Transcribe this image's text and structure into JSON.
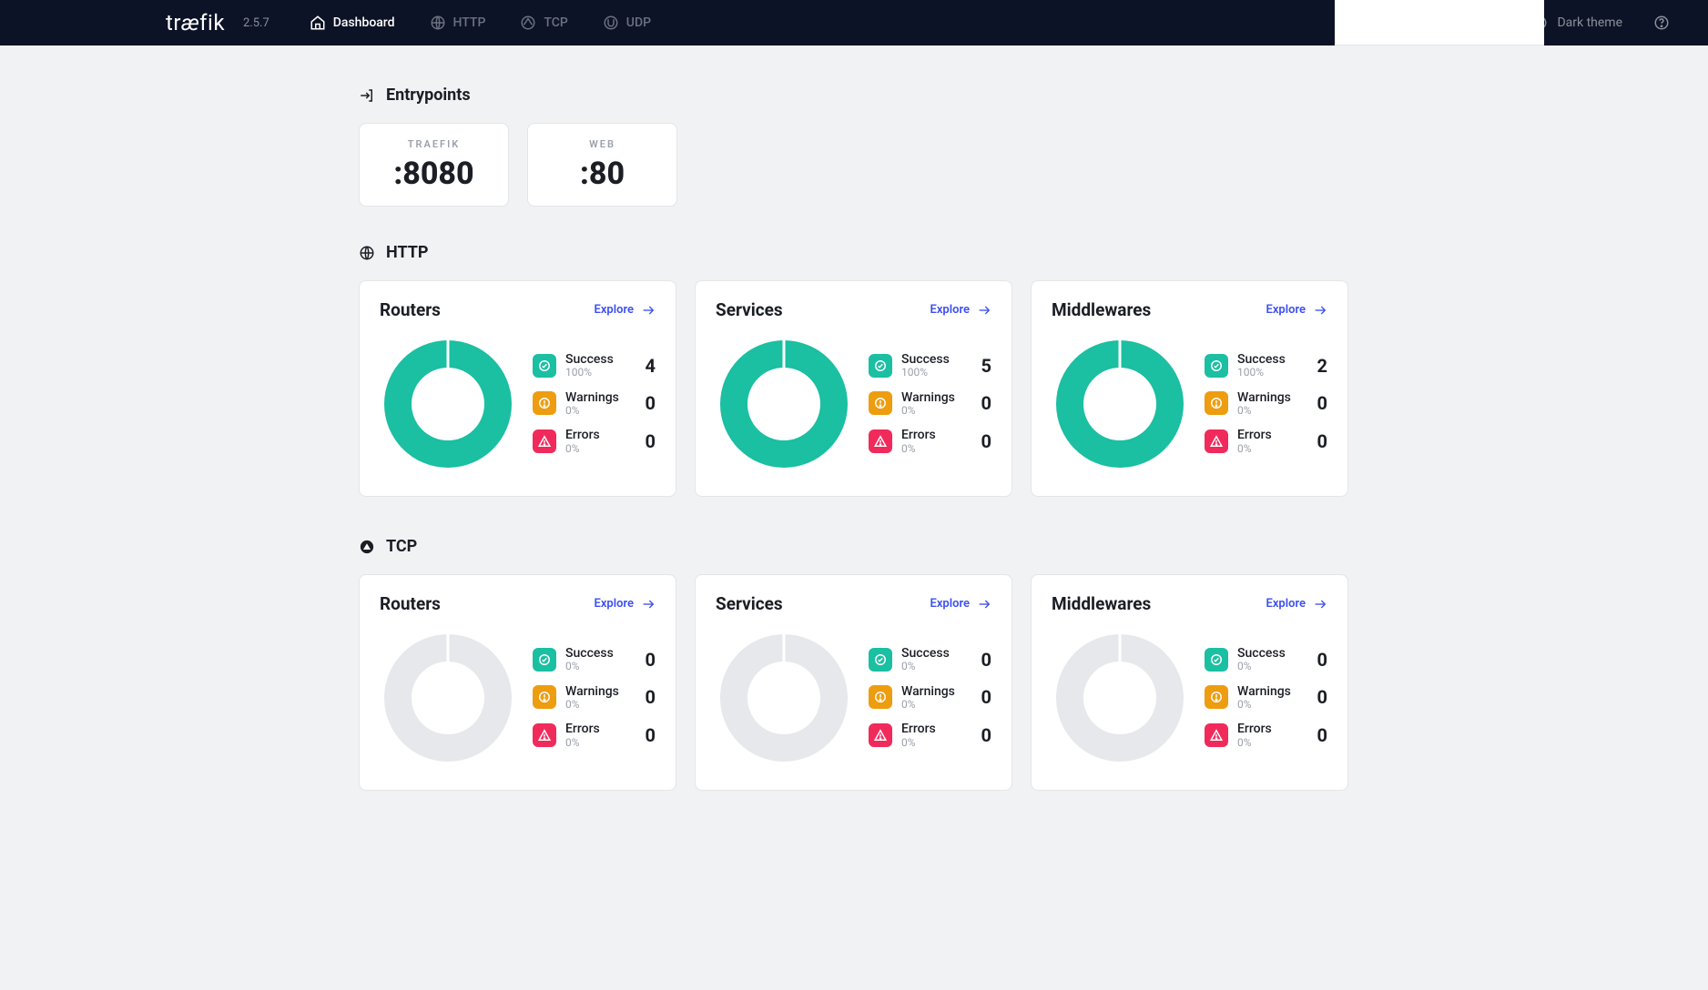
{
  "app": {
    "name": "træfik",
    "version": "2.5.7"
  },
  "nav": {
    "dashboard": "Dashboard",
    "http": "HTTP",
    "tcp": "TCP",
    "udp": "UDP",
    "dark_theme": "Dark theme"
  },
  "colors": {
    "success": "#1bbfa2",
    "warning": "#ed9d0f",
    "error": "#f12a5c",
    "empty": "#e6e8ec",
    "accent": "#3b4ff0"
  },
  "labels": {
    "entrypoints": "Entrypoints",
    "http": "HTTP",
    "tcp": "TCP",
    "explore": "Explore",
    "success": "Success",
    "warnings": "Warnings",
    "errors": "Errors"
  },
  "entrypoints": [
    {
      "name": "TRAEFIK",
      "port": ":8080"
    },
    {
      "name": "WEB",
      "port": ":80"
    }
  ],
  "chart_data": [
    {
      "type": "pie",
      "group": "HTTP",
      "title": "Routers",
      "series": [
        {
          "name": "Success",
          "value": 4,
          "pct": "100%"
        },
        {
          "name": "Warnings",
          "value": 0,
          "pct": "0%"
        },
        {
          "name": "Errors",
          "value": 0,
          "pct": "0%"
        }
      ]
    },
    {
      "type": "pie",
      "group": "HTTP",
      "title": "Services",
      "series": [
        {
          "name": "Success",
          "value": 5,
          "pct": "100%"
        },
        {
          "name": "Warnings",
          "value": 0,
          "pct": "0%"
        },
        {
          "name": "Errors",
          "value": 0,
          "pct": "0%"
        }
      ]
    },
    {
      "type": "pie",
      "group": "HTTP",
      "title": "Middlewares",
      "series": [
        {
          "name": "Success",
          "value": 2,
          "pct": "100%"
        },
        {
          "name": "Warnings",
          "value": 0,
          "pct": "0%"
        },
        {
          "name": "Errors",
          "value": 0,
          "pct": "0%"
        }
      ]
    },
    {
      "type": "pie",
      "group": "TCP",
      "title": "Routers",
      "series": [
        {
          "name": "Success",
          "value": 0,
          "pct": "0%"
        },
        {
          "name": "Warnings",
          "value": 0,
          "pct": "0%"
        },
        {
          "name": "Errors",
          "value": 0,
          "pct": "0%"
        }
      ]
    },
    {
      "type": "pie",
      "group": "TCP",
      "title": "Services",
      "series": [
        {
          "name": "Success",
          "value": 0,
          "pct": "0%"
        },
        {
          "name": "Warnings",
          "value": 0,
          "pct": "0%"
        },
        {
          "name": "Errors",
          "value": 0,
          "pct": "0%"
        }
      ]
    },
    {
      "type": "pie",
      "group": "TCP",
      "title": "Middlewares",
      "series": [
        {
          "name": "Success",
          "value": 0,
          "pct": "0%"
        },
        {
          "name": "Warnings",
          "value": 0,
          "pct": "0%"
        },
        {
          "name": "Errors",
          "value": 0,
          "pct": "0%"
        }
      ]
    }
  ]
}
